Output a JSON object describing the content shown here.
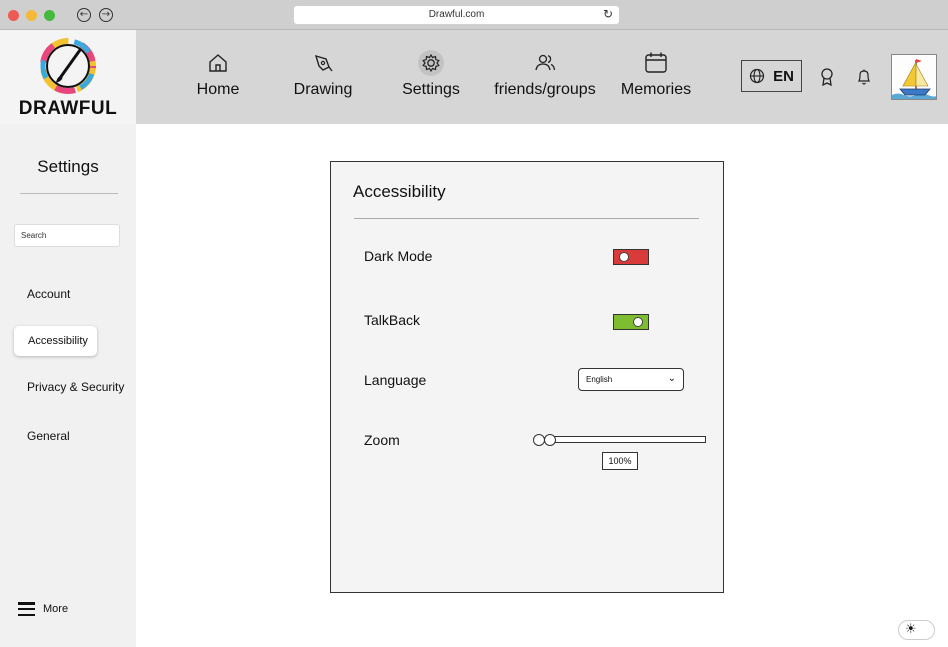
{
  "browser": {
    "url": "Drawful.com"
  },
  "header": {
    "logo_text": "DRAWFUL",
    "nav": [
      {
        "label": "Home",
        "icon": "home-icon"
      },
      {
        "label": "Drawing",
        "icon": "pen-nib-icon"
      },
      {
        "label": "Settings",
        "icon": "gear-icon"
      },
      {
        "label": "friends/groups",
        "icon": "users-icon"
      },
      {
        "label": "Memories",
        "icon": "calendar-icon"
      }
    ],
    "language": "EN",
    "icons": [
      "globe-icon",
      "award-icon",
      "bell-icon"
    ]
  },
  "sidebar": {
    "title": "Settings",
    "search_placeholder": "Search",
    "items": [
      {
        "label": "Account",
        "active": false
      },
      {
        "label": "Accessibility",
        "active": true
      },
      {
        "label": "Privacy & Security",
        "active": false
      },
      {
        "label": "General",
        "active": false
      }
    ],
    "more_label": "More"
  },
  "panel": {
    "title": "Accessibility",
    "dark_mode": {
      "label": "Dark Mode",
      "enabled": false,
      "color": "#d93a3a"
    },
    "talkback": {
      "label": "TalkBack",
      "enabled": true,
      "color": "#7ebd2f"
    },
    "language": {
      "label": "Language",
      "selected": "English"
    },
    "zoom": {
      "label": "Zoom",
      "value": "100%"
    }
  },
  "colors": {
    "header_bg": "#d6d6d6",
    "sidebar_bg": "#f1f1f1",
    "panel_bg": "#f4f4f4"
  }
}
